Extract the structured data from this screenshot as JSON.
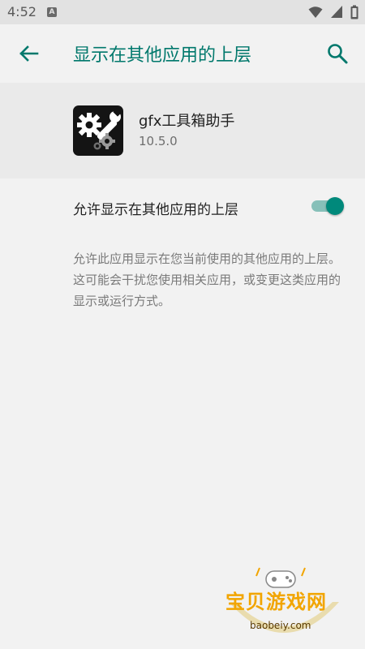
{
  "status_bar": {
    "time": "4:52",
    "notification_letter": "A",
    "icons": [
      "wifi-icon",
      "signal-icon",
      "battery-icon"
    ]
  },
  "app_bar": {
    "title": "显示在其他应用的上层",
    "back_icon": "arrow-back-icon",
    "search_icon": "search-icon",
    "accent_color": "#00786c"
  },
  "app_info": {
    "name": "gfx工具箱助手",
    "version": "10.5.0",
    "icon": "wrench-gears-icon"
  },
  "setting": {
    "label": "允许显示在其他应用的上层",
    "enabled": true,
    "toggle_color": "#00897b"
  },
  "description": "允许此应用显示在您当前使用的其他应用的上层。这可能会干扰您使用相关应用，或变更这类应用的显示或运行方式。",
  "watermark": {
    "text": "宝贝游戏网",
    "url": "baobeiy.com"
  }
}
